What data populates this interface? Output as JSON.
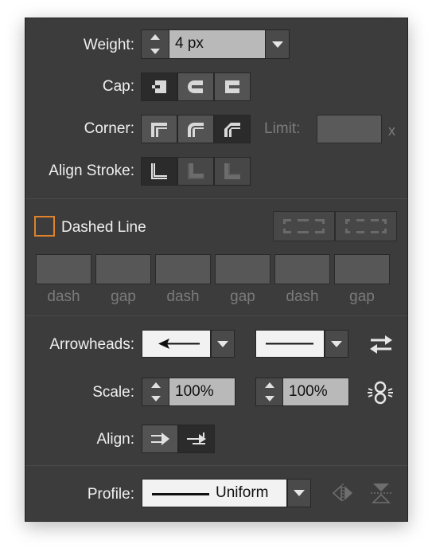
{
  "weight": {
    "label": "Weight:",
    "value": "4 px"
  },
  "cap": {
    "label": "Cap:",
    "options": [
      "butt-cap",
      "round-cap",
      "projecting-cap"
    ],
    "selected": 0
  },
  "corner": {
    "label": "Corner:",
    "options": [
      "miter-join",
      "round-join",
      "bevel-join"
    ],
    "selected": 2,
    "limit_label": "Limit:",
    "limit_value": "",
    "limit_suffix": "x"
  },
  "align_stroke": {
    "label": "Align Stroke:",
    "options": [
      "align-center",
      "align-inside",
      "align-outside"
    ],
    "selected": 0
  },
  "dashed": {
    "label": "Dashed Line",
    "checked": false,
    "fields": [
      {
        "value": "",
        "label": "dash"
      },
      {
        "value": "",
        "label": "gap"
      },
      {
        "value": "",
        "label": "dash"
      },
      {
        "value": "",
        "label": "gap"
      },
      {
        "value": "",
        "label": "dash"
      },
      {
        "value": "",
        "label": "gap"
      }
    ]
  },
  "arrowheads": {
    "label": "Arrowheads:",
    "start": "arrow-left",
    "end": "none"
  },
  "scale": {
    "label": "Scale:",
    "start": "100%",
    "end": "100%"
  },
  "align": {
    "label": "Align:",
    "selected": 1
  },
  "profile": {
    "label": "Profile:",
    "value": "Uniform"
  },
  "colors": {
    "panel": "#3c3c3c",
    "field": "#b9b9b9",
    "checkbox_border": "#e0822a",
    "text": "#f0f0f0"
  }
}
